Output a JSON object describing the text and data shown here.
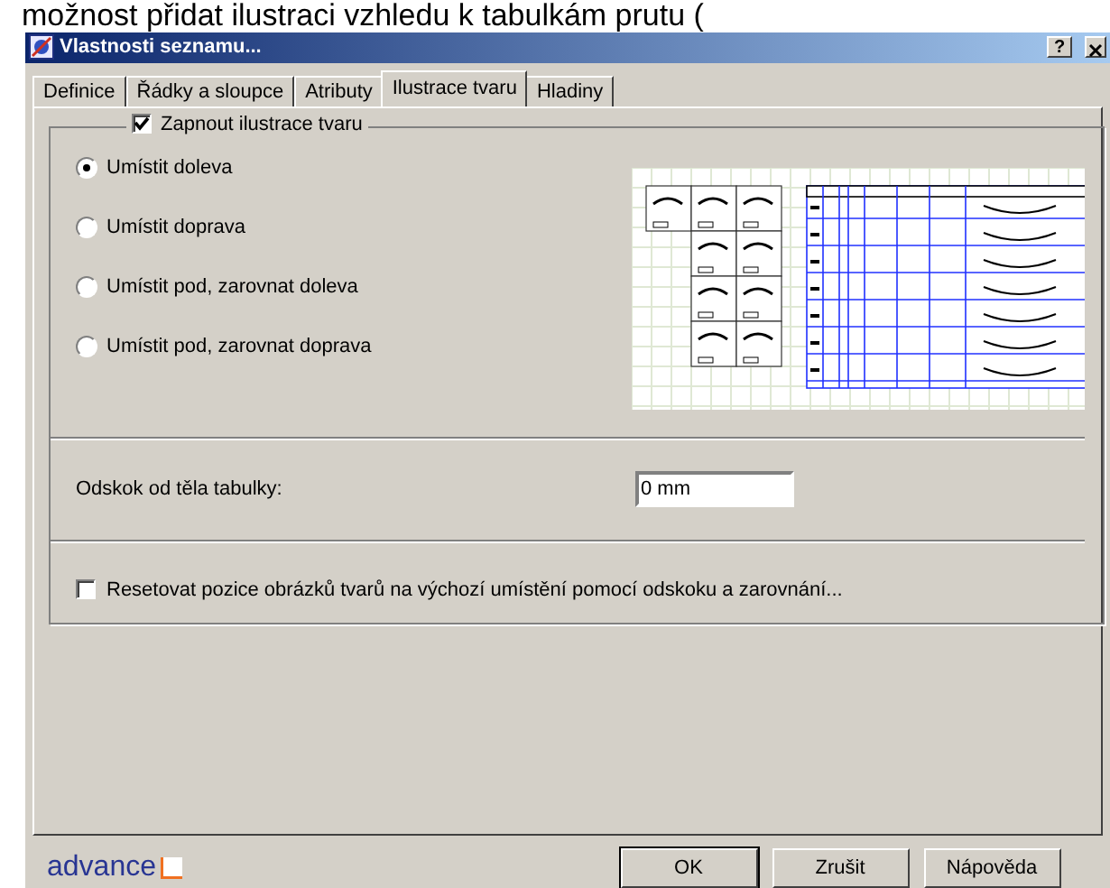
{
  "caption": "možnost přidat ilustraci vzhledu k tabulkám prutu (",
  "window": {
    "title": "Vlastnosti seznamu...",
    "help": "?"
  },
  "tabs": [
    {
      "label": "Definice",
      "selected": false
    },
    {
      "label": "Řádky a sloupce",
      "selected": false
    },
    {
      "label": "Atributy",
      "selected": false
    },
    {
      "label": "Ilustrace tvaru",
      "selected": true
    },
    {
      "label": "Hladiny",
      "selected": false
    }
  ],
  "enable": {
    "label": "Zapnout ilustrace tvaru",
    "checked": true
  },
  "placement": [
    {
      "label": "Umístit doleva",
      "selected": true
    },
    {
      "label": "Umístit doprava",
      "selected": false
    },
    {
      "label": "Umístit pod, zarovnat doleva",
      "selected": false
    },
    {
      "label": "Umístit pod, zarovnat doprava",
      "selected": false
    }
  ],
  "offset": {
    "label": "Odskok od těla tabulky:",
    "value": "0 mm"
  },
  "reset": {
    "label": "Resetovat pozice obrázků tvarů na výchozí umístění pomocí odskoku a zarovnání...",
    "checked": false
  },
  "logo": "advance",
  "buttons": [
    "OK",
    "Zrušit",
    "Nápověda"
  ]
}
